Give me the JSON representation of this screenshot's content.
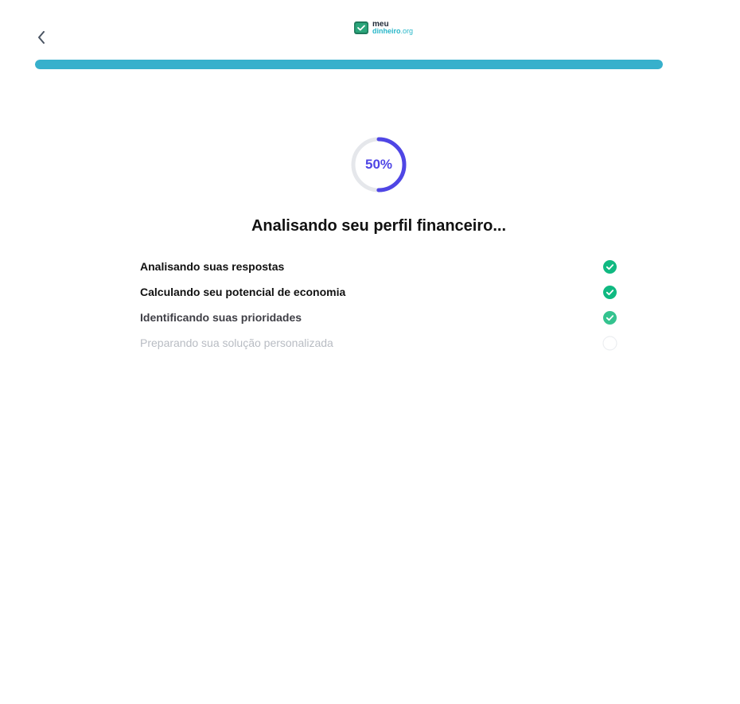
{
  "header": {
    "back_icon": "chevron-left-icon",
    "logo": {
      "line1": "meu",
      "line2": "dinheiro",
      "tld": ".org",
      "icon": "wallet-check-icon"
    }
  },
  "progress": {
    "fraction": 1.0,
    "color": "#37b0cc"
  },
  "loader": {
    "percent_label": "50%",
    "percent_value": 50,
    "color": "#4f46e5",
    "track_color": "#e5e7eb"
  },
  "title": "Analisando seu perfil financeiro...",
  "steps": [
    {
      "label": "Analisando suas respostas",
      "status": "done"
    },
    {
      "label": "Calculando seu potencial de economia",
      "status": "done"
    },
    {
      "label": "Identificando suas prioridades",
      "status": "active"
    },
    {
      "label": "Preparando sua solução personalizada",
      "status": "pending"
    }
  ],
  "colors": {
    "check_done": "#10b981",
    "check_active": "#34c38f",
    "pending_circle": "#eceef1"
  }
}
